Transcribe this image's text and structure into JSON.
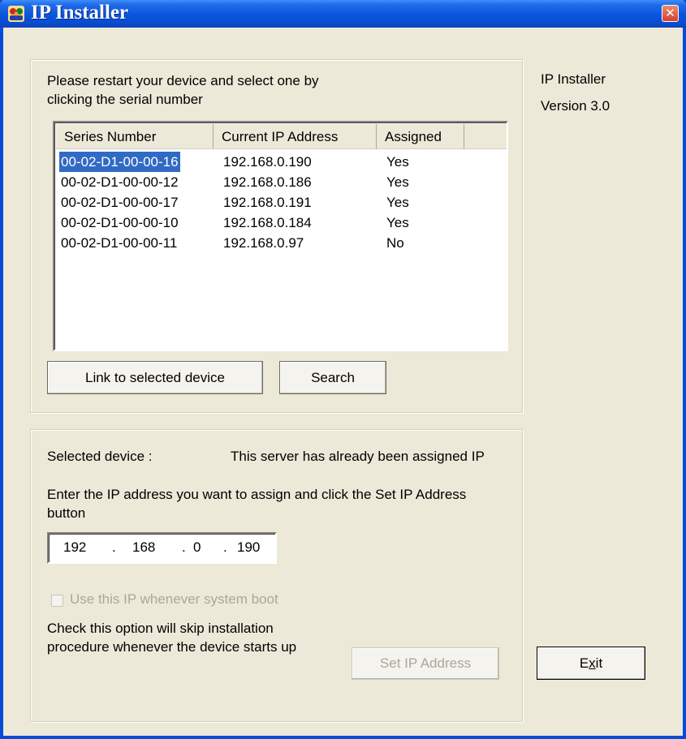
{
  "window": {
    "title": "IP Installer"
  },
  "side": {
    "app_name": "IP Installer",
    "version": "Version 3.0"
  },
  "device_group": {
    "instruction_line1": "Please restart your device and select one by",
    "instruction_line2": "clicking the serial number",
    "columns": [
      "Series Number",
      "Current IP Address",
      "Assigned"
    ],
    "rows": [
      {
        "serial": "00-02-D1-00-00-16",
        "ip": "192.168.0.190",
        "assigned": "Yes",
        "selected": true
      },
      {
        "serial": "00-02-D1-00-00-12",
        "ip": "192.168.0.186",
        "assigned": "Yes",
        "selected": false
      },
      {
        "serial": "00-02-D1-00-00-17",
        "ip": "192.168.0.191",
        "assigned": "Yes",
        "selected": false
      },
      {
        "serial": "00-02-D1-00-00-10",
        "ip": "192.168.0.184",
        "assigned": "Yes",
        "selected": false
      },
      {
        "serial": "00-02-D1-00-00-11",
        "ip": "192.168.0.97",
        "assigned": "No",
        "selected": false
      }
    ],
    "link_button": "Link to selected device",
    "search_button": "Search"
  },
  "assign_group": {
    "selected_label": "Selected device :",
    "status_message": "This server has already been assigned IP",
    "instruction_line1": "Enter the IP address you want to assign and click the Set IP Address",
    "instruction_line2": "button",
    "ip": [
      "192",
      "168",
      "0",
      "190"
    ],
    "checkbox_label": "Use this IP whenever system boot",
    "note_line1": "Check this option will skip installation",
    "note_line2": "procedure whenever the device starts up",
    "set_ip_button": "Set IP Address"
  },
  "exit_button": {
    "label_pre": "E",
    "label_underlined": "x",
    "label_post": "it"
  },
  "colors": {
    "title_bar": "#0a55de",
    "face": "#ece9d8",
    "selection": "#316ac5",
    "disabled_text": "#a9a899"
  }
}
